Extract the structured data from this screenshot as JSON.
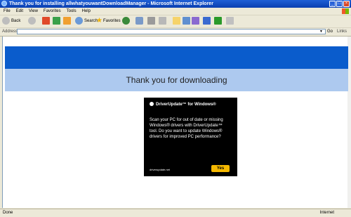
{
  "window": {
    "title": "Thank you for installing allwhatyouwantDownloadManager - Microsoft Internet Explorer"
  },
  "menu": {
    "items": [
      "File",
      "Edit",
      "View",
      "Favorites",
      "Tools",
      "Help"
    ]
  },
  "toolbar": {
    "back_label": "Back",
    "search_label": "Search",
    "favorites_label": "Favorites"
  },
  "address": {
    "label": "Address",
    "go_label": "Go",
    "links_label": "Links"
  },
  "page": {
    "heading": "Thank you for downloading"
  },
  "ad": {
    "brand": "DriverUpdate™ for Windows®",
    "body": "Scan your PC for out of date or missing Windows® drivers with DriverUpdate™ tool. Do you want to update Windows® drivers for improved PC performance?",
    "site": "driverupdate.net",
    "yes_label": "Yes"
  },
  "status": {
    "left": "Done",
    "right": "Internet"
  },
  "colors": {
    "titlebar": "#0a3fb0",
    "banner": "#0a5ccc",
    "banner_light": "#adc9ef",
    "ad_bg": "#000000",
    "yes_btn": "#f5b800"
  }
}
